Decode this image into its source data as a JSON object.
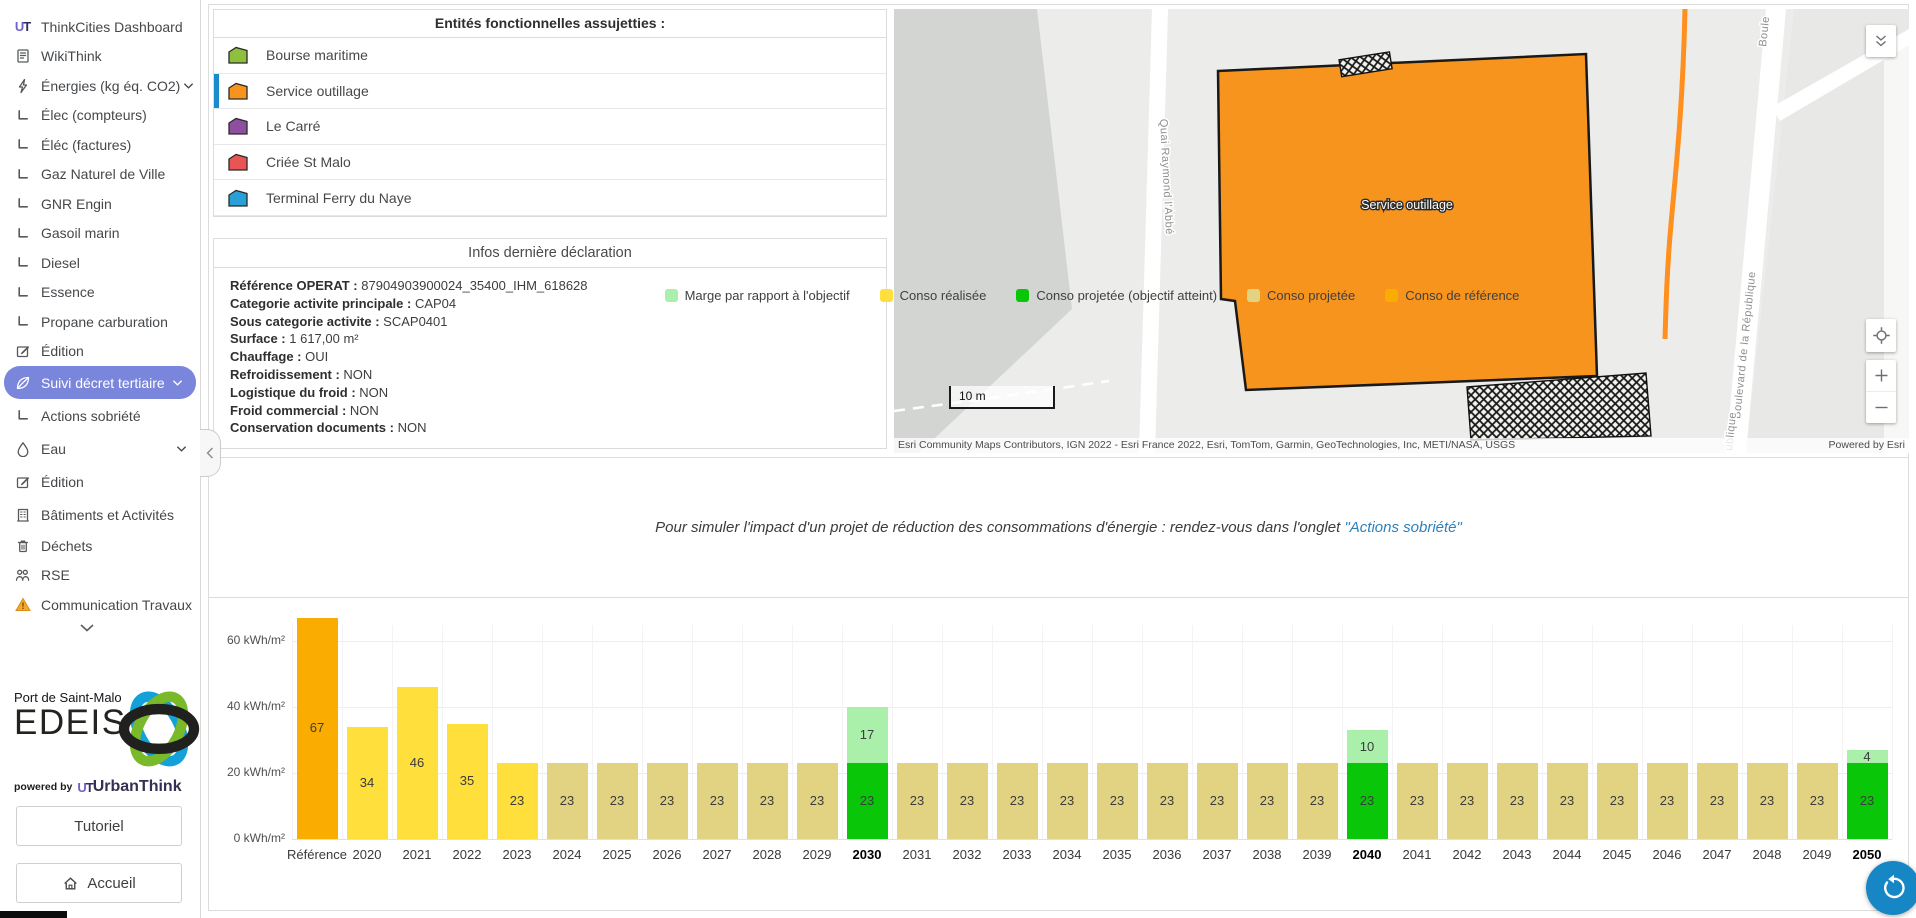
{
  "sidebar": {
    "items": [
      {
        "label": "ThinkCities Dashboard",
        "icon": "ut-logo"
      },
      {
        "label": "WikiThink",
        "icon": "scroll"
      },
      {
        "label": "Énergies (kg éq. CO2)",
        "icon": "lightning",
        "chevron": true
      },
      {
        "label": "Élec (compteurs)",
        "icon": "sub"
      },
      {
        "label": "Éléc (factures)",
        "icon": "sub"
      },
      {
        "label": "Gaz Naturel de Ville",
        "icon": "sub"
      },
      {
        "label": "GNR Engin",
        "icon": "sub"
      },
      {
        "label": "Gasoil marin",
        "icon": "sub"
      },
      {
        "label": "Diesel",
        "icon": "sub"
      },
      {
        "label": "Essence",
        "icon": "sub"
      },
      {
        "label": "Propane carburation",
        "icon": "sub"
      },
      {
        "label": "Édition",
        "icon": "edit"
      },
      {
        "label": "Suivi décret tertiaire",
        "icon": "leaf",
        "chevron": true,
        "chevron_right": true,
        "selected": true
      },
      {
        "label": "Actions sobriété",
        "icon": "sub"
      },
      {
        "label": "Eau",
        "icon": "droplet",
        "chevron": true,
        "chevron_right": true
      },
      {
        "label": "Édition",
        "icon": "edit"
      },
      {
        "label": "Bâtiments et Activités",
        "icon": "building"
      },
      {
        "label": "Déchets",
        "icon": "trash"
      },
      {
        "label": "RSE",
        "icon": "people"
      },
      {
        "label": "Communication Travaux",
        "icon": "warning"
      }
    ],
    "selected_color": "#7a86db",
    "logo": {
      "city": "Port de Saint-Malo",
      "name": "EDEIS"
    },
    "powered_by": "powered by",
    "powered_brand": "UrbanThink",
    "tutorial_button": "Tutoriel",
    "home_button": "Accueil"
  },
  "entities_panel": {
    "title": "Entités fonctionnelles assujetties :",
    "selected_bar_color": "#1a8cce",
    "items": [
      {
        "label": "Bourse maritime",
        "color": "#8fc03d",
        "selected": false
      },
      {
        "label": "Service outillage",
        "color": "#f7941e",
        "selected": true
      },
      {
        "label": "Le Carré",
        "color": "#8d4f9e",
        "selected": false
      },
      {
        "label": "Criée St Malo",
        "color": "#e85555",
        "selected": false
      },
      {
        "label": "Terminal Ferry du Naye",
        "color": "#29a0d8",
        "selected": false
      }
    ]
  },
  "infos_panel": {
    "title": "Infos dernière déclaration",
    "fields": [
      {
        "label": "Référence OPERAT",
        "value": "87904903900024_35400_IHM_618628"
      },
      {
        "label": "Categorie activite principale",
        "value": "CAP04"
      },
      {
        "label": "Sous categorie activite",
        "value": "SCAP0401"
      },
      {
        "label": "Surface",
        "value": "1 617,00 m²"
      },
      {
        "label": "Chauffage",
        "value": "OUI"
      },
      {
        "label": "Refroidissement",
        "value": "NON"
      },
      {
        "label": "Logistique du froid",
        "value": "NON"
      },
      {
        "label": "Froid commercial",
        "value": "NON"
      },
      {
        "label": "Conservation documents",
        "value": "NON"
      }
    ]
  },
  "map": {
    "street_quai": "Quai Raymond l'Abbé",
    "street_boulevard": "Boulevard de la République",
    "street_boulevard_top": "Boule",
    "street_boulevard_bottom": "ublique",
    "polygon_label": "Service outillage",
    "polygon_color": "#f7941e",
    "scale_label": "10 m",
    "attribution": "Esri Community Maps Contributors, IGN 2022 - Esri France 2022, Esri, TomTom, Garmin, GeoTechnologies, Inc, METI/NASA, USGS",
    "powered": "Powered by Esri"
  },
  "note": {
    "prefix": "Pour simuler l'impact d'un projet de réduction des consommations d'énergie : rendez-vous dans l'onglet ",
    "link": "\"Actions sobriété\""
  },
  "chart_data": {
    "type": "bar",
    "stacked": true,
    "title": "",
    "xlabel": "",
    "ylabel": "kWh/m²",
    "yticks": [
      0,
      20,
      40,
      60
    ],
    "ytick_labels": [
      "0 kWh/m²",
      "20 kWh/m²",
      "40 kWh/m²",
      "60 kWh/m²"
    ],
    "ylim": [
      0,
      70
    ],
    "grid": true,
    "legend_position": "bottom",
    "colors": {
      "reference": "#fbac00",
      "realisee": "#ffdf3c",
      "projetee": "#e2d383",
      "atteint": "#09c609",
      "marge": "#aaefaa"
    },
    "legend": [
      {
        "label": "Marge par rapport à l'objectif",
        "key": "marge"
      },
      {
        "label": "Conso réalisée",
        "key": "realisee"
      },
      {
        "label": "Conso projetée (objectif atteint)",
        "key": "atteint"
      },
      {
        "label": "Conso projetée",
        "key": "projetee"
      },
      {
        "label": "Conso de référence",
        "key": "reference"
      }
    ],
    "bars": [
      {
        "category": "Référence",
        "segments": [
          {
            "value": 67,
            "key": "reference"
          }
        ]
      },
      {
        "category": "2020",
        "segments": [
          {
            "value": 34,
            "key": "realisee"
          }
        ]
      },
      {
        "category": "2021",
        "segments": [
          {
            "value": 46,
            "key": "realisee"
          }
        ]
      },
      {
        "category": "2022",
        "segments": [
          {
            "value": 35,
            "key": "realisee"
          }
        ]
      },
      {
        "category": "2023",
        "segments": [
          {
            "value": 23,
            "key": "realisee"
          }
        ]
      },
      {
        "category": "2024",
        "segments": [
          {
            "value": 23,
            "key": "projetee"
          }
        ]
      },
      {
        "category": "2025",
        "segments": [
          {
            "value": 23,
            "key": "projetee"
          }
        ]
      },
      {
        "category": "2026",
        "segments": [
          {
            "value": 23,
            "key": "projetee"
          }
        ]
      },
      {
        "category": "2027",
        "segments": [
          {
            "value": 23,
            "key": "projetee"
          }
        ]
      },
      {
        "category": "2028",
        "segments": [
          {
            "value": 23,
            "key": "projetee"
          }
        ]
      },
      {
        "category": "2029",
        "segments": [
          {
            "value": 23,
            "key": "projetee"
          }
        ]
      },
      {
        "category": "2030",
        "milestone": true,
        "segments": [
          {
            "value": 23,
            "key": "atteint"
          },
          {
            "value": 17,
            "key": "marge"
          }
        ]
      },
      {
        "category": "2031",
        "segments": [
          {
            "value": 23,
            "key": "projetee"
          }
        ]
      },
      {
        "category": "2032",
        "segments": [
          {
            "value": 23,
            "key": "projetee"
          }
        ]
      },
      {
        "category": "2033",
        "segments": [
          {
            "value": 23,
            "key": "projetee"
          }
        ]
      },
      {
        "category": "2034",
        "segments": [
          {
            "value": 23,
            "key": "projetee"
          }
        ]
      },
      {
        "category": "2035",
        "segments": [
          {
            "value": 23,
            "key": "projetee"
          }
        ]
      },
      {
        "category": "2036",
        "segments": [
          {
            "value": 23,
            "key": "projetee"
          }
        ]
      },
      {
        "category": "2037",
        "segments": [
          {
            "value": 23,
            "key": "projetee"
          }
        ]
      },
      {
        "category": "2038",
        "segments": [
          {
            "value": 23,
            "key": "projetee"
          }
        ]
      },
      {
        "category": "2039",
        "segments": [
          {
            "value": 23,
            "key": "projetee"
          }
        ]
      },
      {
        "category": "2040",
        "milestone": true,
        "segments": [
          {
            "value": 23,
            "key": "atteint"
          },
          {
            "value": 10,
            "key": "marge"
          }
        ]
      },
      {
        "category": "2041",
        "segments": [
          {
            "value": 23,
            "key": "projetee"
          }
        ]
      },
      {
        "category": "2042",
        "segments": [
          {
            "value": 23,
            "key": "projetee"
          }
        ]
      },
      {
        "category": "2043",
        "segments": [
          {
            "value": 23,
            "key": "projetee"
          }
        ]
      },
      {
        "category": "2044",
        "segments": [
          {
            "value": 23,
            "key": "projetee"
          }
        ]
      },
      {
        "category": "2045",
        "segments": [
          {
            "value": 23,
            "key": "projetee"
          }
        ]
      },
      {
        "category": "2046",
        "segments": [
          {
            "value": 23,
            "key": "projetee"
          }
        ]
      },
      {
        "category": "2047",
        "segments": [
          {
            "value": 23,
            "key": "projetee"
          }
        ]
      },
      {
        "category": "2048",
        "segments": [
          {
            "value": 23,
            "key": "projetee"
          }
        ]
      },
      {
        "category": "2049",
        "segments": [
          {
            "value": 23,
            "key": "projetee"
          }
        ]
      },
      {
        "category": "2050",
        "milestone": true,
        "segments": [
          {
            "value": 23,
            "key": "atteint"
          },
          {
            "value": 4,
            "key": "marge"
          }
        ]
      }
    ]
  },
  "fab_color": "#1786c5"
}
